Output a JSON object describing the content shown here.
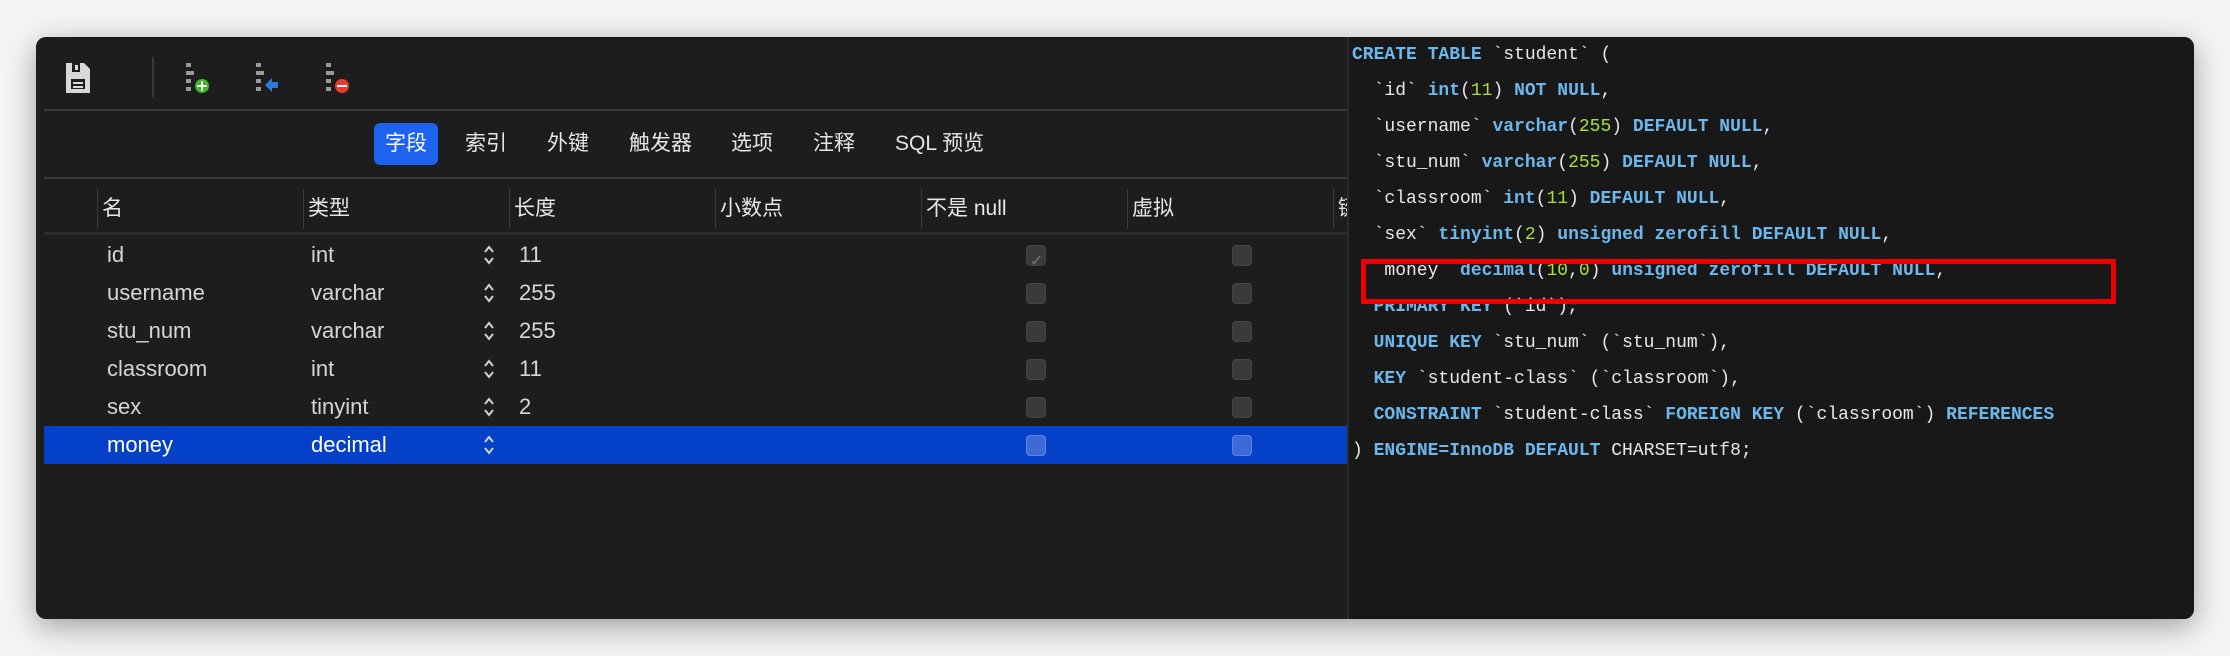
{
  "toolbar": {
    "save": "save-icon",
    "add_field": "add-field-icon",
    "insert_field": "insert-field-icon",
    "delete_field": "delete-field-icon"
  },
  "tabs": [
    {
      "label": "字段",
      "active": true
    },
    {
      "label": "索引"
    },
    {
      "label": "外键"
    },
    {
      "label": "触发器"
    },
    {
      "label": "选项"
    },
    {
      "label": "注释"
    },
    {
      "label": "SQL 预览"
    }
  ],
  "columns": [
    "名",
    "类型",
    "长度",
    "小数点",
    "不是 null",
    "虚拟",
    "键"
  ],
  "rows": [
    {
      "name": "id",
      "type": "int",
      "length": "11",
      "not_null": true,
      "virtual": false
    },
    {
      "name": "username",
      "type": "varchar",
      "length": "255",
      "not_null": false,
      "virtual": false
    },
    {
      "name": "stu_num",
      "type": "varchar",
      "length": "255",
      "not_null": false,
      "virtual": false
    },
    {
      "name": "classroom",
      "type": "int",
      "length": "11",
      "not_null": false,
      "virtual": false
    },
    {
      "name": "sex",
      "type": "tinyint",
      "length": "2",
      "not_null": false,
      "virtual": false
    },
    {
      "name": "money",
      "type": "decimal",
      "length": "",
      "not_null": false,
      "virtual": false,
      "selected": true
    }
  ],
  "sql_lines": [
    [
      [
        "kw",
        "CREATE TABLE"
      ],
      [
        "t",
        " `student` ("
      ]
    ],
    [
      [
        "t",
        "  `id` "
      ],
      [
        "kw",
        "int"
      ],
      [
        "t",
        "("
      ],
      [
        "num",
        "11"
      ],
      [
        "t",
        ") "
      ],
      [
        "kw",
        "NOT NULL"
      ],
      [
        "t",
        ","
      ]
    ],
    [
      [
        "t",
        "  `username` "
      ],
      [
        "kw",
        "varchar"
      ],
      [
        "t",
        "("
      ],
      [
        "num",
        "255"
      ],
      [
        "t",
        ") "
      ],
      [
        "kw",
        "DEFAULT NULL"
      ],
      [
        "t",
        ","
      ]
    ],
    [
      [
        "t",
        "  `stu_num` "
      ],
      [
        "kw",
        "varchar"
      ],
      [
        "t",
        "("
      ],
      [
        "num",
        "255"
      ],
      [
        "t",
        ") "
      ],
      [
        "kw",
        "DEFAULT NULL"
      ],
      [
        "t",
        ","
      ]
    ],
    [
      [
        "t",
        "  `classroom` "
      ],
      [
        "kw",
        "int"
      ],
      [
        "t",
        "("
      ],
      [
        "num",
        "11"
      ],
      [
        "t",
        ") "
      ],
      [
        "kw",
        "DEFAULT NULL"
      ],
      [
        "t",
        ","
      ]
    ],
    [
      [
        "t",
        "  `sex` "
      ],
      [
        "kw",
        "tinyint"
      ],
      [
        "t",
        "("
      ],
      [
        "num",
        "2"
      ],
      [
        "t",
        ") "
      ],
      [
        "kw",
        "unsigned zerofill DEFAULT NULL"
      ],
      [
        "t",
        ","
      ]
    ],
    [
      [
        "t",
        "  `money` "
      ],
      [
        "kw",
        "decimal"
      ],
      [
        "t",
        "("
      ],
      [
        "num",
        "10"
      ],
      [
        "t",
        ","
      ],
      [
        "num",
        "0"
      ],
      [
        "t",
        ") "
      ],
      [
        "kw",
        "unsigned zerofill DEFAULT NULL"
      ],
      [
        "t",
        ","
      ]
    ],
    [
      [
        "t",
        "  "
      ],
      [
        "kw",
        "PRIMARY KEY"
      ],
      [
        "t",
        " (`id`),"
      ]
    ],
    [
      [
        "t",
        "  "
      ],
      [
        "kw",
        "UNIQUE KEY"
      ],
      [
        "t",
        " `stu_num` (`stu_num`),"
      ]
    ],
    [
      [
        "t",
        "  "
      ],
      [
        "kw",
        "KEY"
      ],
      [
        "t",
        " `student-class` (`classroom`),"
      ]
    ],
    [
      [
        "t",
        "  "
      ],
      [
        "kw",
        "CONSTRAINT"
      ],
      [
        "t",
        " `student-class` "
      ],
      [
        "kw",
        "FOREIGN KEY"
      ],
      [
        "t",
        " (`classroom`) "
      ],
      [
        "kw",
        "REFERENCES"
      ]
    ],
    [
      [
        "t",
        ") "
      ],
      [
        "kw",
        "ENGINE=InnoDB DEFAULT"
      ],
      [
        "t",
        " CHARSET=utf8;"
      ]
    ]
  ],
  "colors": {
    "accent": "#1e62f0",
    "selected_row": "#0440c8",
    "keyword": "#6cb8ec",
    "number": "#a8e03a",
    "highlight_box": "#ee0000"
  }
}
